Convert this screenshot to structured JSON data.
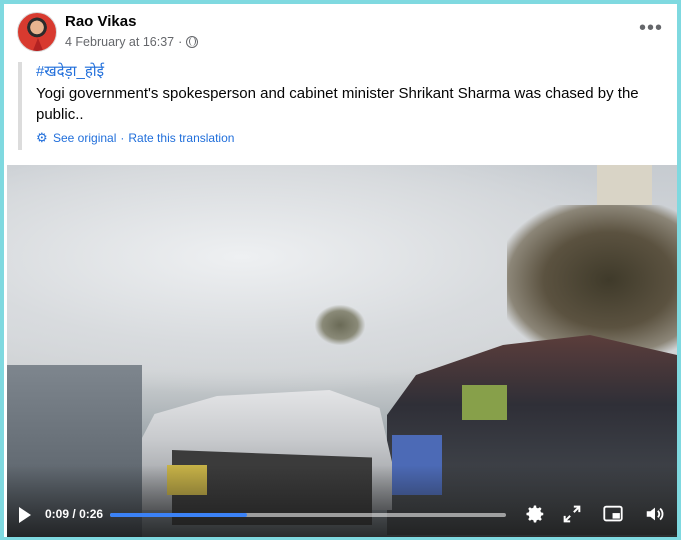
{
  "post": {
    "author": "Rao Vikas",
    "timestamp": "4 February at 16:37",
    "separator": "·",
    "more_options": "•••",
    "hashtag": "#खदेड़ा_होई",
    "text": "Yogi government's spokesperson and cabinet minister Shrikant Sharma was chased by the public..",
    "translation": {
      "see_original": "See original",
      "separator": "·",
      "rate": "Rate this translation"
    }
  },
  "video": {
    "current_time": "0:09",
    "time_separator": "/",
    "duration": "0:26",
    "progress_fraction": 0.346,
    "accent_color": "#3b82f6",
    "icons": [
      "play-icon",
      "settings-icon",
      "fullscreen-icon",
      "picture-in-picture-icon",
      "volume-icon"
    ]
  },
  "colors": {
    "link": "#216fdb",
    "frame_border": "#7fd9e0"
  }
}
